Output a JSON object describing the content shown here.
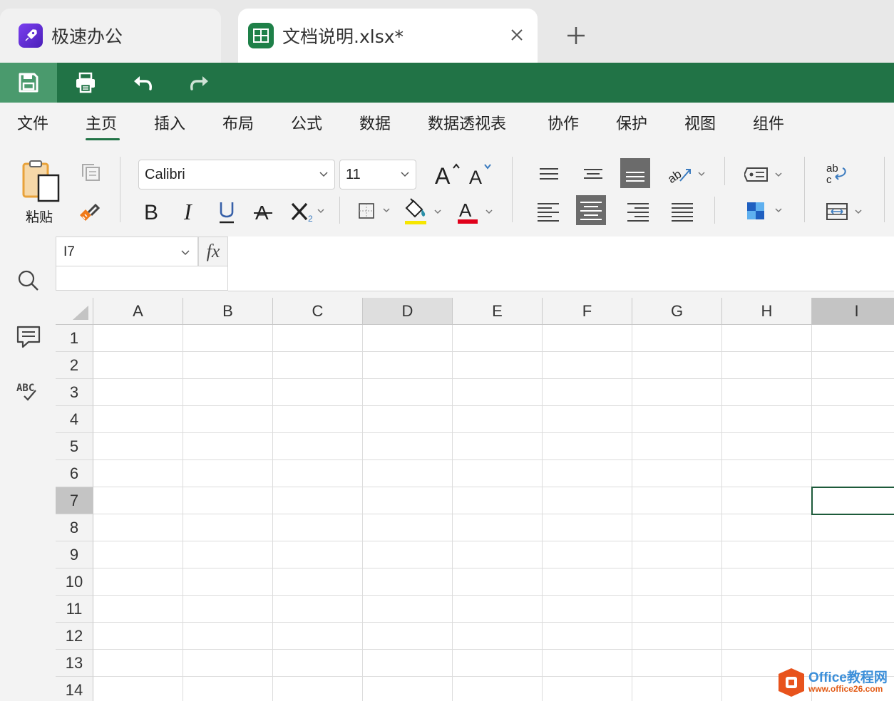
{
  "tabs": [
    {
      "title": "极速办公"
    },
    {
      "title": "文档说明.xlsx*"
    }
  ],
  "quick_access": [
    "save-icon",
    "print-icon",
    "undo-icon",
    "redo-icon"
  ],
  "menu": [
    "文件",
    "主页",
    "插入",
    "布局",
    "公式",
    "数据",
    "数据透视表",
    "协作",
    "保护",
    "视图",
    "组件"
  ],
  "menu_active": "主页",
  "ribbon": {
    "paste_label": "粘贴",
    "font_name": "Calibri",
    "font_size": "11",
    "font_color_indicator": "#e0001b",
    "fill_color_indicator": "#f6e600"
  },
  "formula_bar": {
    "name_box": "I7",
    "fx_label": "fx",
    "formula": ""
  },
  "grid": {
    "columns": [
      "A",
      "B",
      "C",
      "D",
      "E",
      "F",
      "G",
      "H",
      "I"
    ],
    "rows": [
      "1",
      "2",
      "3",
      "4",
      "5",
      "6",
      "7",
      "8",
      "9",
      "10",
      "11",
      "12",
      "13",
      "14"
    ],
    "highlighted_column": "D",
    "active_column": "I",
    "active_row": "7"
  },
  "watermark": {
    "title": "Office教程网",
    "url": "www.office26.com"
  },
  "colors": {
    "accent_green": "#217346",
    "active_quick_button": "#4a9a6d"
  }
}
